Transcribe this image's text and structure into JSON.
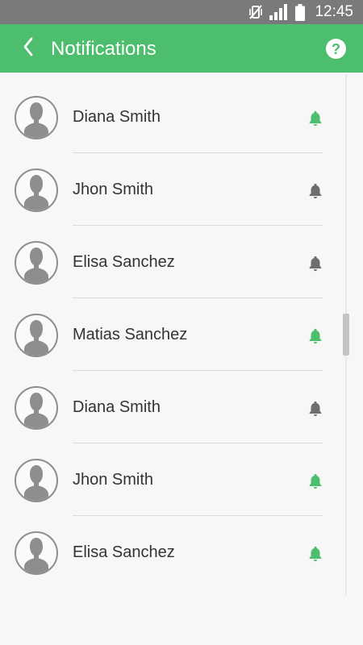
{
  "status_bar": {
    "time": "12:45",
    "icons": [
      "vibrate-muted-icon",
      "signal-icon",
      "battery-icon"
    ]
  },
  "app_bar": {
    "title": "Notifications",
    "back_icon": "chevron-left-icon",
    "help_icon": "help-icon",
    "help_glyph": "?",
    "background": "#4cbe6d"
  },
  "colors": {
    "bell_on": "#4cbe6d",
    "bell_off": "#6e6e6e",
    "avatar": "#8e8e8e"
  },
  "contacts": [
    {
      "name": "Diana Smith",
      "notifications_on": true
    },
    {
      "name": "Jhon Smith",
      "notifications_on": false
    },
    {
      "name": "Elisa Sanchez",
      "notifications_on": false
    },
    {
      "name": "Matias Sanchez",
      "notifications_on": true
    },
    {
      "name": "Diana Smith",
      "notifications_on": false
    },
    {
      "name": "Jhon Smith",
      "notifications_on": true
    },
    {
      "name": "Elisa Sanchez",
      "notifications_on": true
    }
  ]
}
